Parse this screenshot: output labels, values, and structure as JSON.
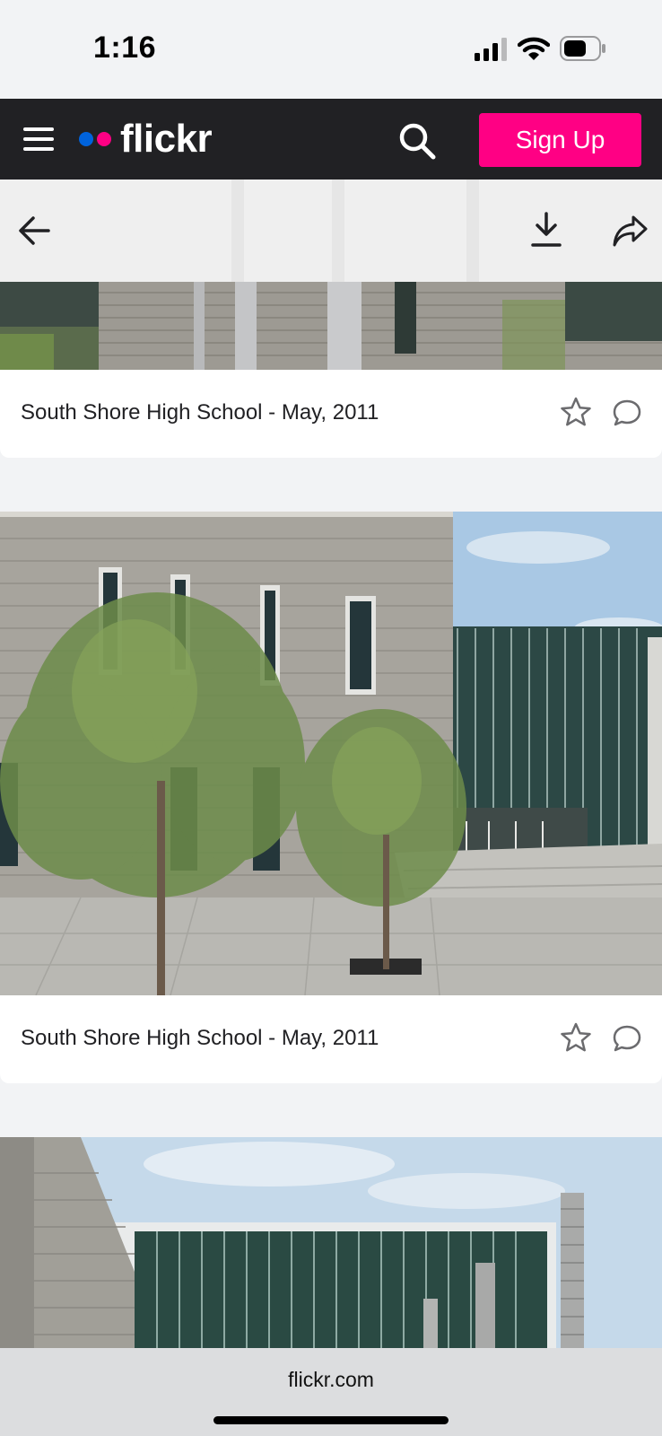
{
  "status_bar": {
    "time": "1:16"
  },
  "nav": {
    "logo_text": "flickr",
    "signup_label": "Sign Up",
    "colors": {
      "background": "#212124",
      "brand_blue": "#0063dc",
      "brand_pink": "#ff0084",
      "signup": "#ff0084"
    }
  },
  "toolbar": {
    "back_icon": "back-arrow-icon",
    "download_icon": "download-icon",
    "share_icon": "share-icon"
  },
  "feed": {
    "items": [
      {
        "title": "South Shore High School - May, 2011"
      },
      {
        "title": "South Shore High School - May, 2011"
      }
    ]
  },
  "browser": {
    "url": "flickr.com"
  }
}
